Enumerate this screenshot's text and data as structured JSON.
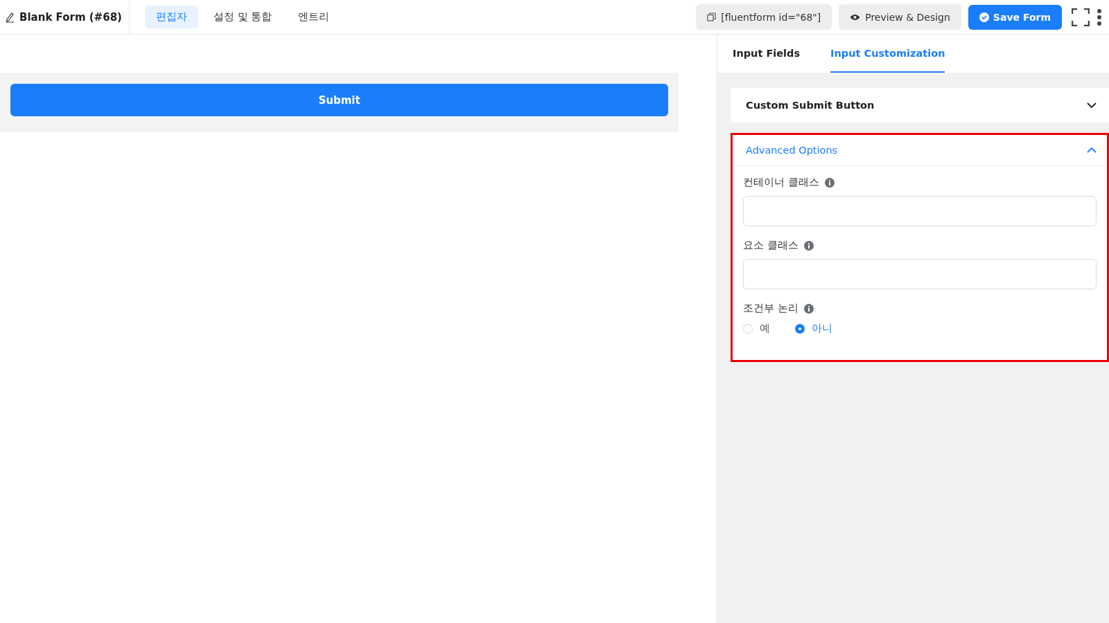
{
  "header": {
    "form_title": "Blank Form (#68)",
    "tabs": [
      {
        "label": "편집자",
        "selected": true
      },
      {
        "label": "설정 및 통합",
        "selected": false
      },
      {
        "label": "엔트리",
        "selected": false
      }
    ],
    "shortcode": "[fluentform id=\"68\"]",
    "preview_button": "Preview & Design",
    "save_button": "Save Form"
  },
  "canvas": {
    "submit_button": "Submit"
  },
  "panel": {
    "tabs": [
      {
        "label": "Input Fields",
        "selected": false
      },
      {
        "label": "Input Customization",
        "selected": true
      }
    ],
    "sections": [
      {
        "title": "Custom Submit Button",
        "expanded": false,
        "highlighted": false
      },
      {
        "title": "Advanced Options",
        "expanded": true,
        "highlighted": true,
        "fields": [
          {
            "kind": "text",
            "label": "컨테이너 클래스"
          },
          {
            "kind": "text",
            "label": "요소 클래스"
          },
          {
            "kind": "radio",
            "label": "조건부 논리",
            "options": [
              {
                "label": "예",
                "selected": false
              },
              {
                "label": "아니",
                "selected": true
              }
            ]
          }
        ]
      }
    ]
  }
}
